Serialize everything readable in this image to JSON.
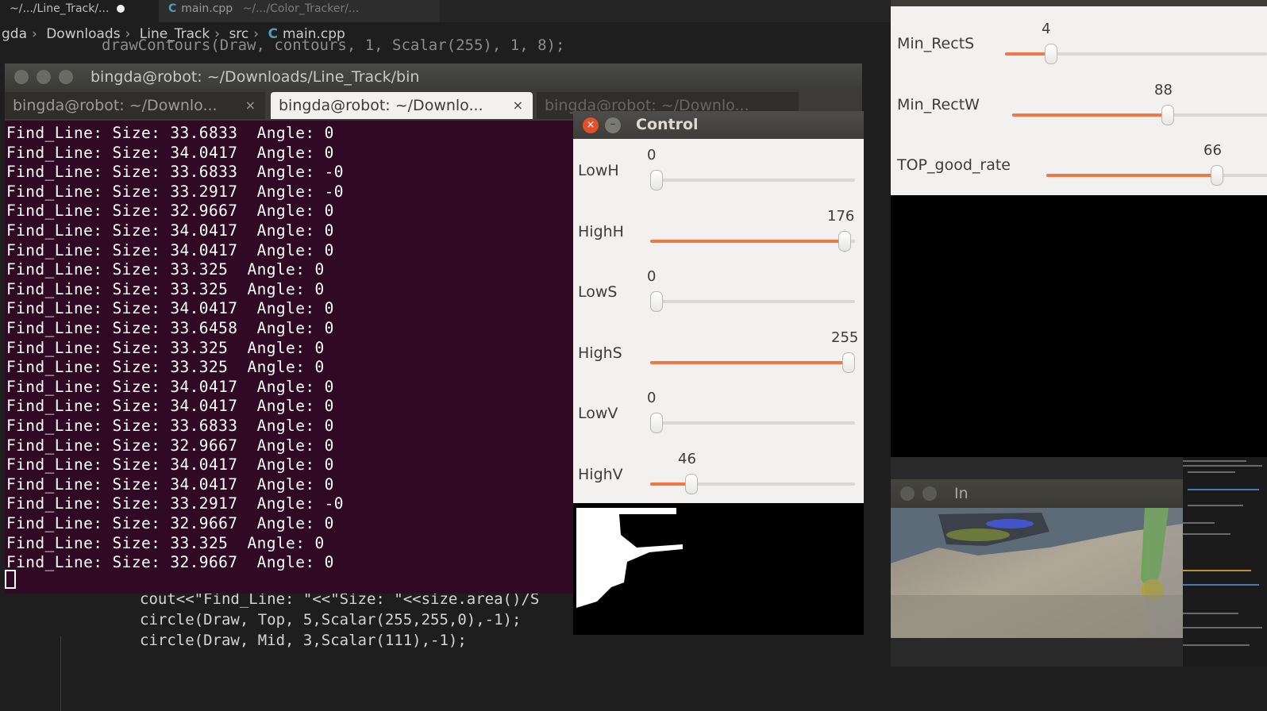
{
  "editor": {
    "tab1": "~/.../Line_Track/...",
    "tab2_icon": "C",
    "tab2_name": "main.cpp",
    "tab2_path": "~/.../Color_Tracker/...",
    "breadcrumb": [
      "gda",
      "Downloads",
      "Line_Track",
      "src",
      "main.cpp"
    ],
    "code_top": "drawContours(Draw, contours, 1, Scalar(255), 1, 8);",
    "code_lines": [
      "cout<<\"Find_Line: \"<<\"Size: \"<<size.area()/S",
      "circle(Draw, Top, 5,Scalar(255,255,0),-1);",
      "circle(Draw, Mid, 3,Scalar(111),-1);"
    ]
  },
  "terminal": {
    "title": "bingda@robot: ~/Downloads/Line_Track/bin",
    "tabs": [
      {
        "label": "bingda@robot: ~/Downlo...",
        "close": "×"
      },
      {
        "label": "bingda@robot: ~/Downlo...",
        "close": "×"
      },
      {
        "label": "bingda@robot: ~/Downlo...",
        "close": ""
      }
    ],
    "lines": [
      "Find_Line: Size: 33.6833  Angle: 0",
      "Find_Line: Size: 34.0417  Angle: 0",
      "Find_Line: Size: 33.6833  Angle: -0",
      "Find_Line: Size: 33.2917  Angle: -0",
      "Find_Line: Size: 32.9667  Angle: 0",
      "Find_Line: Size: 34.0417  Angle: 0",
      "Find_Line: Size: 34.0417  Angle: 0",
      "Find_Line: Size: 33.325  Angle: 0",
      "Find_Line: Size: 33.325  Angle: 0",
      "Find_Line: Size: 34.0417  Angle: 0",
      "Find_Line: Size: 33.6458  Angle: 0",
      "Find_Line: Size: 33.325  Angle: 0",
      "Find_Line: Size: 33.325  Angle: 0",
      "Find_Line: Size: 34.0417  Angle: 0",
      "Find_Line: Size: 34.0417  Angle: 0",
      "Find_Line: Size: 33.6833  Angle: 0",
      "Find_Line: Size: 32.9667  Angle: 0",
      "Find_Line: Size: 34.0417  Angle: 0",
      "Find_Line: Size: 34.0417  Angle: 0",
      "Find_Line: Size: 33.2917  Angle: -0",
      "Find_Line: Size: 32.9667  Angle: 0",
      "Find_Line: Size: 33.325  Angle: 0",
      "Find_Line: Size: 32.9667  Angle: 0"
    ]
  },
  "control": {
    "title": "Control",
    "close_glyph": "×",
    "min_glyph": "–",
    "trackbars": [
      {
        "label": "LowH",
        "value": "0",
        "fraction": 0.0
      },
      {
        "label": "HighH",
        "value": "176",
        "fraction": 0.978
      },
      {
        "label": "LowS",
        "value": "0",
        "fraction": 0.0
      },
      {
        "label": "HighS",
        "value": "255",
        "fraction": 1.0
      },
      {
        "label": "LowV",
        "value": "0",
        "fraction": 0.0
      },
      {
        "label": "HighV",
        "value": "46",
        "fraction": 0.18
      }
    ]
  },
  "right_window": {
    "trackbars": [
      {
        "label": "Min_RectS",
        "value": "4",
        "fraction": 0.16
      },
      {
        "label": "Min_RectW",
        "value": "88",
        "fraction": 0.6
      },
      {
        "label": "TOP_good_rate",
        "value": "66",
        "fraction": 0.66
      }
    ]
  },
  "in_window": {
    "title": "In"
  },
  "colors": {
    "terminal_bg": "#300a24",
    "slider_fill": "#f07746",
    "close_button": "#e1502a",
    "dialog_bg": "#f2f1f0"
  }
}
